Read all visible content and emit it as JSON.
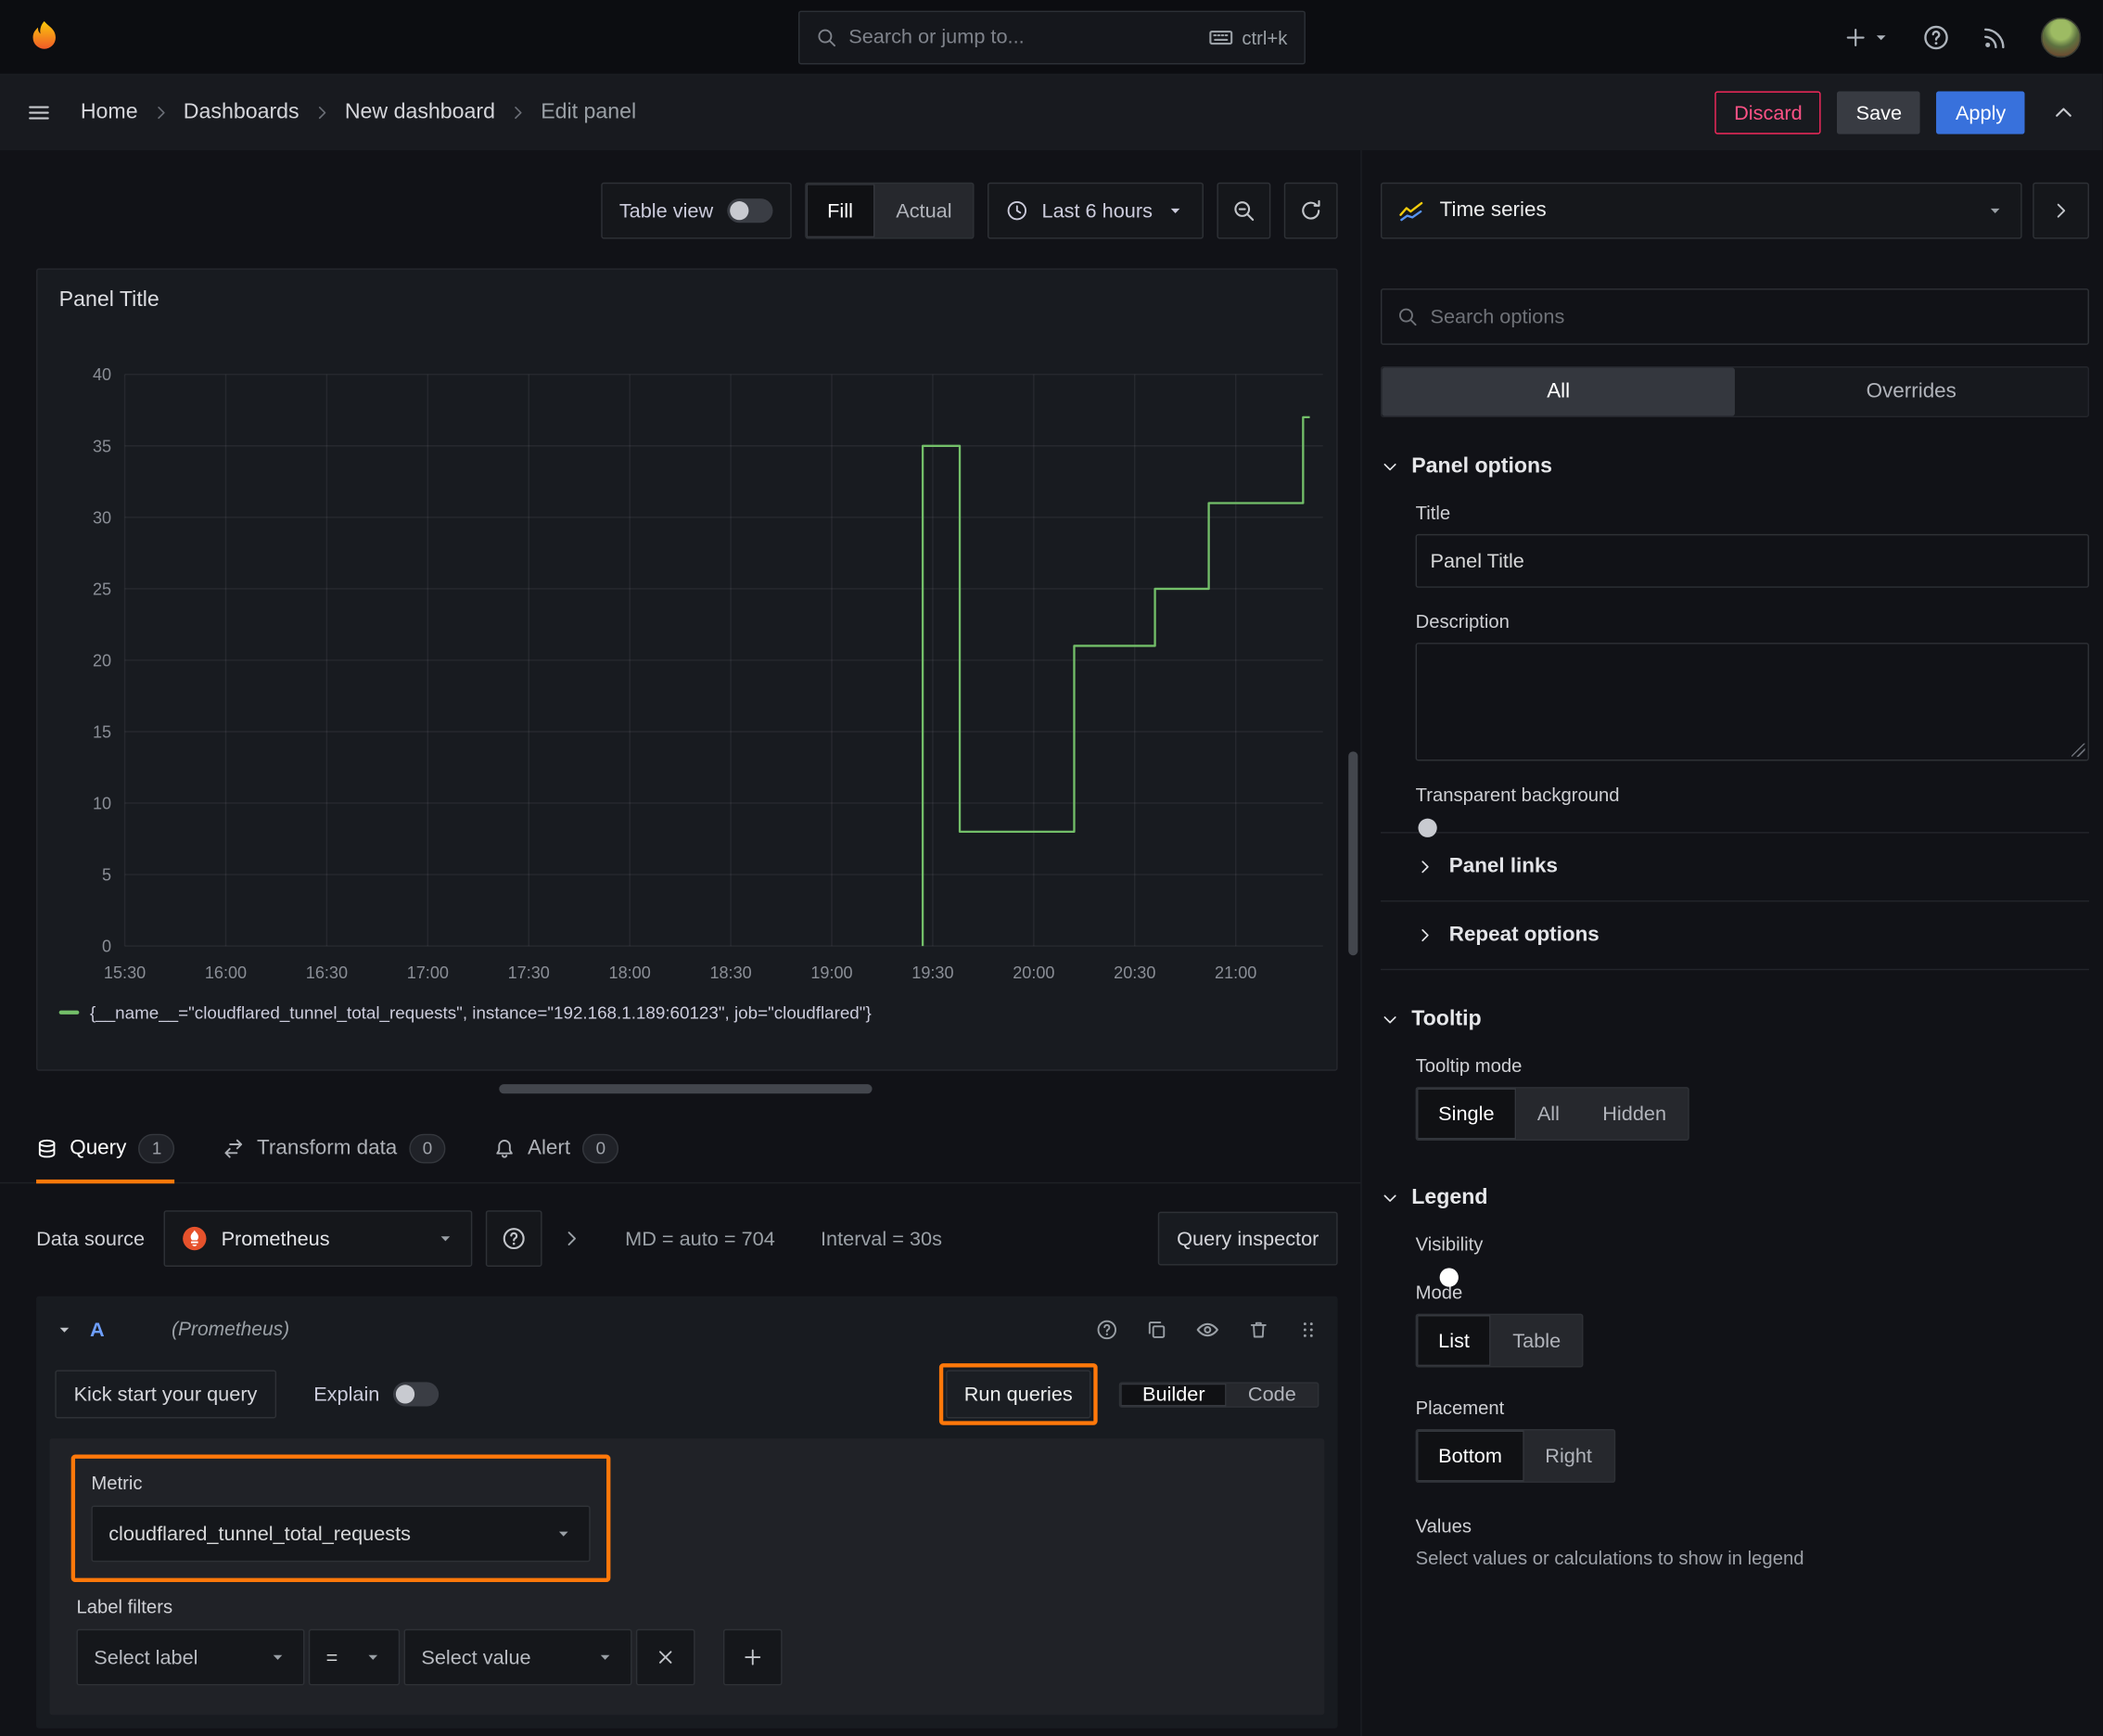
{
  "topnav": {
    "search_placeholder": "Search or jump to...",
    "shortcut": "ctrl+k"
  },
  "breadcrumb": {
    "items": [
      "Home",
      "Dashboards",
      "New dashboard",
      "Edit panel"
    ]
  },
  "header_actions": {
    "discard": "Discard",
    "save": "Save",
    "apply": "Apply"
  },
  "panel_toolbar": {
    "table_view": "Table view",
    "fill": "Fill",
    "actual": "Actual",
    "time_range": "Last 6 hours"
  },
  "panel": {
    "title": "Panel Title"
  },
  "chart_data": {
    "type": "line",
    "title": "Panel Title",
    "xlabel": "",
    "ylabel": "",
    "ylim": [
      0,
      40
    ],
    "y_ticks": [
      0,
      5,
      10,
      15,
      20,
      25,
      30,
      35,
      40
    ],
    "x_ticks": [
      "15:30",
      "16:00",
      "16:30",
      "17:00",
      "17:30",
      "18:00",
      "18:30",
      "19:00",
      "19:30",
      "20:00",
      "20:30",
      "21:00"
    ],
    "grid": true,
    "legend_position": "bottom",
    "series": [
      {
        "name": "{__name__=\"cloudflared_tunnel_total_requests\", instance=\"192.168.1.189:60123\", job=\"cloudflared\"}",
        "color": "#73bf69",
        "step": true,
        "points": [
          [
            "19:27",
            0
          ],
          [
            "19:27",
            35
          ],
          [
            "19:38",
            35
          ],
          [
            "19:38",
            8
          ],
          [
            "20:12",
            8
          ],
          [
            "20:12",
            21
          ],
          [
            "20:36",
            21
          ],
          [
            "20:36",
            25
          ],
          [
            "20:52",
            25
          ],
          [
            "20:52",
            31
          ],
          [
            "21:20",
            31
          ],
          [
            "21:20",
            37
          ],
          [
            "21:22",
            37
          ]
        ]
      }
    ]
  },
  "tabs": [
    {
      "label": "Query",
      "count": "1"
    },
    {
      "label": "Transform data",
      "count": "0"
    },
    {
      "label": "Alert",
      "count": "0"
    }
  ],
  "query": {
    "data_source_label": "Data source",
    "data_source": "Prometheus",
    "stats": "MD = auto = 704",
    "interval": "Interval = 30s",
    "inspector": "Query inspector",
    "ref": "A",
    "ref_ds": "(Prometheus)",
    "kick": "Kick start your query",
    "explain": "Explain",
    "run": "Run queries",
    "builder": "Builder",
    "code": "Code",
    "metric_label": "Metric",
    "metric": "cloudflared_tunnel_total_requests",
    "filters_label": "Label filters",
    "select_label": "Select label",
    "op": "=",
    "select_value": "Select value"
  },
  "options": {
    "viz": "Time series",
    "search_placeholder": "Search options",
    "tab_all": "All",
    "tab_overrides": "Overrides",
    "panel_options": "Panel options",
    "title_label": "Title",
    "title_value": "Panel Title",
    "description_label": "Description",
    "transparent_label": "Transparent background",
    "panel_links": "Panel links",
    "repeat_options": "Repeat options",
    "tooltip": {
      "header": "Tooltip",
      "mode_label": "Tooltip mode",
      "single": "Single",
      "all": "All",
      "hidden": "Hidden"
    },
    "legend": {
      "header": "Legend",
      "visibility": "Visibility",
      "mode_label": "Mode",
      "list": "List",
      "table": "Table",
      "placement_label": "Placement",
      "bottom": "Bottom",
      "right": "Right",
      "values_label": "Values",
      "values_desc": "Select values or calculations to show in legend"
    }
  },
  "colors": {
    "annotation_orange": "#ff780a",
    "accent_blue": "#3871dc",
    "series_green": "#73bf69",
    "discard_red": "#ff5286"
  }
}
